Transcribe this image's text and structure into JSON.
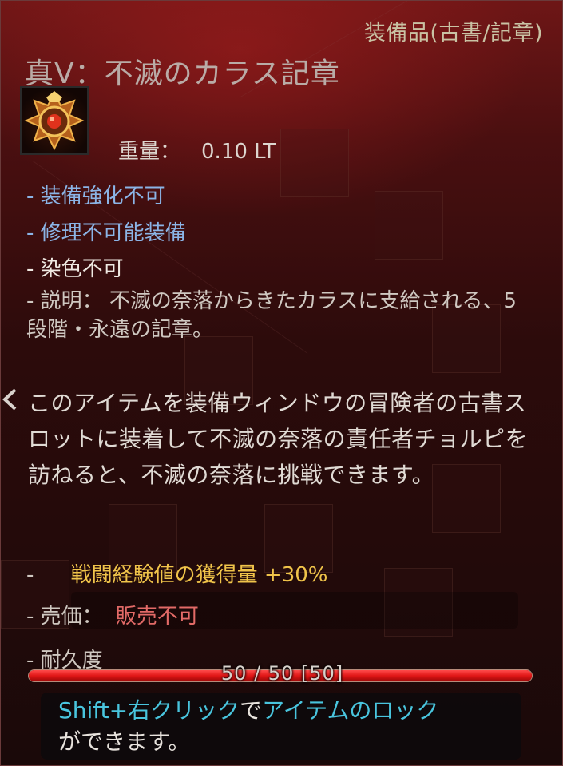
{
  "tooltip": {
    "category": "装備品(古書/記章)",
    "item_name": "真V：不滅のカラス記章",
    "icon": "crow-emblem-icon",
    "weight_label": "重量：",
    "weight_value": "0.10 LT",
    "props": [
      "- 装備強化不可",
      "- 修理不可能装備",
      "- 染色不可"
    ],
    "description": "- 説明： 不滅の奈落からきたカラスに支給される、5段階・永遠の記章。",
    "flavor": "このアイテムを装備ウィンドウの冒険者の古書スロットに装着して不滅の奈落の責任者チョルピを訪ねると、不滅の奈落に挑戦できます。",
    "bonus_dash": "-",
    "bonus_text": "戦闘経験値の獲得量 +30%",
    "sell_label": "- 売価：",
    "sell_value": "販売不可",
    "durability_label": "- 耐久度",
    "durability": {
      "current": 50,
      "max": 50,
      "text": "50 / 50 [50]"
    },
    "hint": {
      "part1": "Shift+右クリック",
      "part2": "で",
      "part3": "アイテムのロック",
      "part4": "ができます。"
    }
  },
  "colors": {
    "accent_blue": "#8bb4e6",
    "bonus_gold": "#f0c44a",
    "sell_red": "#e26a67",
    "hint_cyan": "#49c5de",
    "bar_red": "#e01616"
  }
}
